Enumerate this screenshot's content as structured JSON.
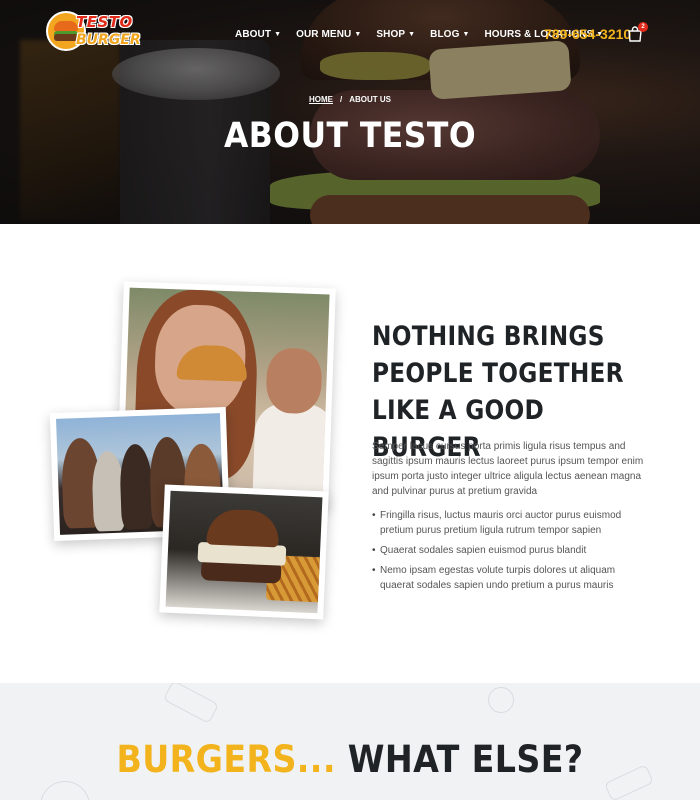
{
  "brand": {
    "line1": "TESTO",
    "line2": "BURGER"
  },
  "nav": {
    "items": [
      {
        "label": "ABOUT",
        "name": "nav-about"
      },
      {
        "label": "OUR MENU",
        "name": "nav-our-menu"
      },
      {
        "label": "SHOP",
        "name": "nav-shop"
      },
      {
        "label": "BLOG",
        "name": "nav-blog"
      },
      {
        "label": "HOURS & LOCATIONS",
        "name": "nav-hours-locations"
      }
    ],
    "phone": "789-654-3210",
    "cart_count": "2"
  },
  "hero": {
    "breadcrumb_home": "HOME",
    "breadcrumb_sep": "/",
    "breadcrumb_current": "ABOUT US",
    "title": "ABOUT TESTO"
  },
  "about": {
    "heading": "NOTHING BRINGS PEOPLE TOGETHER LIKE A GOOD BURGER",
    "paragraph": "Semper lacus cursus porta primis ligula risus tempus and sagittis ipsum mauris lectus laoreet purus ipsum tempor enim ipsum porta justo integer ultrice aligula lectus aenean magna and pulvinar purus at pretium gravida",
    "bullets": [
      "Fringilla risus, luctus mauris orci auctor purus euismod pretium purus pretium ligula rutrum tempor sapien",
      "Quaerat sodales sapien euismod purus blandit",
      "Nemo ipsam egestas volute turpis dolores ut aliquam quaerat sodales sapien undo pretium a purus mauris"
    ]
  },
  "section2": {
    "title_highlight": "BURGERS...",
    "title_rest": " WHAT ELSE?"
  },
  "colors": {
    "accent": "#f2b31c",
    "brand_red": "#e02a1a",
    "heading": "#1f2326"
  }
}
